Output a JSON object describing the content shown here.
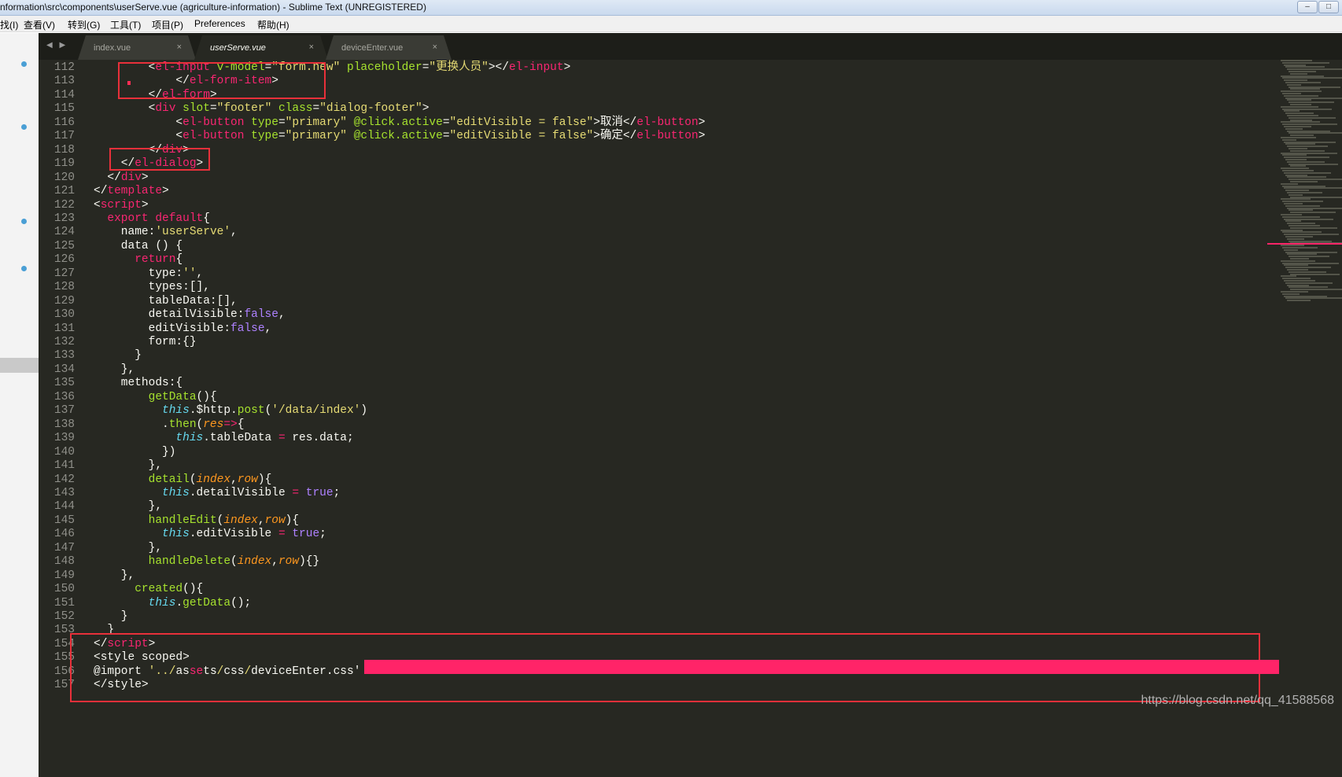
{
  "window": {
    "title": "nformation\\src\\components\\userServe.vue (agriculture-information) - Sublime Text (UNREGISTERED)",
    "buttons": [
      "–",
      "□"
    ]
  },
  "menu": [
    "找(I)",
    "查看(V)",
    "转到(G)",
    "工具(T)",
    "项目(P)",
    "Preferences",
    "帮助(H)"
  ],
  "tabs": {
    "nav": "◀ ▶",
    "items": [
      {
        "label": "index.vue",
        "close": "×",
        "active": false
      },
      {
        "label": "userServe.vue",
        "close": "×",
        "active": true
      },
      {
        "label": "deviceEnter.vue",
        "close": "×",
        "active": false
      }
    ]
  },
  "lines": [
    {
      "n": "112",
      "t": [
        [
          "        ",
          "txt"
        ],
        [
          "<",
          "txt"
        ],
        [
          "el-input",
          "tag"
        ],
        [
          " v-model",
          "attr"
        ],
        [
          "=",
          "txt"
        ],
        [
          "\"form.new\"",
          "str"
        ],
        [
          " placeholder",
          "attr"
        ],
        [
          "=",
          "txt"
        ],
        [
          "\"更换人员\"",
          "str"
        ],
        [
          "></",
          "txt"
        ],
        [
          "el-input",
          "tag"
        ],
        [
          ">",
          "txt"
        ]
      ]
    },
    {
      "n": "113",
      "t": [
        [
          "            </",
          "txt"
        ],
        [
          "el-form-item",
          "tag"
        ],
        [
          ">",
          "txt"
        ]
      ]
    },
    {
      "n": "114",
      "t": [
        [
          "        </",
          "txt"
        ],
        [
          "el-form",
          "tag"
        ],
        [
          ">",
          "txt"
        ]
      ]
    },
    {
      "n": "115",
      "t": [
        [
          "        <",
          "txt"
        ],
        [
          "div",
          "tag"
        ],
        [
          " slot",
          "attr"
        ],
        [
          "=",
          "txt"
        ],
        [
          "\"footer\"",
          "str"
        ],
        [
          " class",
          "attr"
        ],
        [
          "=",
          "txt"
        ],
        [
          "\"dialog-footer\"",
          "str"
        ],
        [
          ">",
          "txt"
        ]
      ]
    },
    {
      "n": "116",
      "t": [
        [
          "            <",
          "txt"
        ],
        [
          "el-button",
          "tag"
        ],
        [
          " type",
          "attr"
        ],
        [
          "=",
          "txt"
        ],
        [
          "\"primary\"",
          "str"
        ],
        [
          " @click.active",
          "attr"
        ],
        [
          "=",
          "txt"
        ],
        [
          "\"editVisible = false\"",
          "str"
        ],
        [
          ">取消</",
          "txt"
        ],
        [
          "el-button",
          "tag"
        ],
        [
          ">",
          "txt"
        ]
      ]
    },
    {
      "n": "117",
      "t": [
        [
          "            <",
          "txt"
        ],
        [
          "el-button",
          "tag"
        ],
        [
          " type",
          "attr"
        ],
        [
          "=",
          "txt"
        ],
        [
          "\"primary\"",
          "str"
        ],
        [
          " @click.active",
          "attr"
        ],
        [
          "=",
          "txt"
        ],
        [
          "\"editVisible = false\"",
          "str"
        ],
        [
          ">确定</",
          "txt"
        ],
        [
          "el-button",
          "tag"
        ],
        [
          ">",
          "txt"
        ]
      ]
    },
    {
      "n": "118",
      "t": [
        [
          "        </",
          "txt"
        ],
        [
          "div",
          "tag"
        ],
        [
          ">",
          "txt"
        ]
      ]
    },
    {
      "n": "119",
      "t": [
        [
          "    </",
          "txt"
        ],
        [
          "el-dialog",
          "tag"
        ],
        [
          ">",
          "txt"
        ]
      ]
    },
    {
      "n": "120",
      "t": [
        [
          "  </",
          "txt"
        ],
        [
          "div",
          "tag"
        ],
        [
          ">",
          "txt"
        ]
      ]
    },
    {
      "n": "121",
      "t": [
        [
          "</",
          "txt"
        ],
        [
          "template",
          "tag"
        ],
        [
          ">",
          "txt"
        ]
      ]
    },
    {
      "n": "122",
      "t": [
        [
          "<",
          "txt"
        ],
        [
          "script",
          "tag"
        ],
        [
          ">",
          "txt"
        ]
      ]
    },
    {
      "n": "123",
      "t": [
        [
          "  ",
          "txt"
        ],
        [
          "export default",
          "kw"
        ],
        [
          "{",
          "txt"
        ]
      ]
    },
    {
      "n": "124",
      "t": [
        [
          "    name:",
          "txt"
        ],
        [
          "'userServe'",
          "str"
        ],
        [
          ",",
          "txt"
        ]
      ]
    },
    {
      "n": "125",
      "t": [
        [
          "    data () {",
          "txt"
        ]
      ]
    },
    {
      "n": "126",
      "t": [
        [
          "      ",
          "txt"
        ],
        [
          "return",
          "kw"
        ],
        [
          "{",
          "txt"
        ]
      ]
    },
    {
      "n": "127",
      "t": [
        [
          "        type:",
          "txt"
        ],
        [
          "''",
          "str"
        ],
        [
          ",",
          "txt"
        ]
      ]
    },
    {
      "n": "128",
      "t": [
        [
          "        types:[],",
          "txt"
        ]
      ]
    },
    {
      "n": "129",
      "t": [
        [
          "        tableData:[],",
          "txt"
        ]
      ]
    },
    {
      "n": "130",
      "t": [
        [
          "        detailVisible:",
          "txt"
        ],
        [
          "false",
          "const"
        ],
        [
          ",",
          "txt"
        ]
      ]
    },
    {
      "n": "131",
      "t": [
        [
          "        editVisible:",
          "txt"
        ],
        [
          "false",
          "const"
        ],
        [
          ",",
          "txt"
        ]
      ]
    },
    {
      "n": "132",
      "t": [
        [
          "        form:{}",
          "txt"
        ]
      ]
    },
    {
      "n": "133",
      "t": [
        [
          "      }",
          "txt"
        ]
      ]
    },
    {
      "n": "134",
      "t": [
        [
          "    },",
          "txt"
        ]
      ]
    },
    {
      "n": "135",
      "t": [
        [
          "    methods:{",
          "txt"
        ]
      ]
    },
    {
      "n": "136",
      "t": [
        [
          "        ",
          "txt"
        ],
        [
          "getData",
          "fn"
        ],
        [
          "(){",
          "txt"
        ]
      ]
    },
    {
      "n": "137",
      "t": [
        [
          "          ",
          "txt"
        ],
        [
          "this",
          "this"
        ],
        [
          ".$http.",
          "txt"
        ],
        [
          "post",
          "fn"
        ],
        [
          "(",
          "txt"
        ],
        [
          "'/data/index'",
          "str"
        ],
        [
          ")",
          "txt"
        ]
      ]
    },
    {
      "n": "138",
      "t": [
        [
          "          .",
          "txt"
        ],
        [
          "then",
          "fn"
        ],
        [
          "(",
          "txt"
        ],
        [
          "res",
          "param"
        ],
        [
          "=>",
          "op"
        ],
        [
          "{",
          "txt"
        ]
      ]
    },
    {
      "n": "139",
      "t": [
        [
          "            ",
          "txt"
        ],
        [
          "this",
          "this"
        ],
        [
          ".tableData ",
          "txt"
        ],
        [
          "=",
          "op"
        ],
        [
          " res.data;",
          "txt"
        ]
      ]
    },
    {
      "n": "140",
      "t": [
        [
          "          })",
          "txt"
        ]
      ]
    },
    {
      "n": "141",
      "t": [
        [
          "        },",
          "txt"
        ]
      ]
    },
    {
      "n": "142",
      "t": [
        [
          "        ",
          "txt"
        ],
        [
          "detail",
          "fn"
        ],
        [
          "(",
          "txt"
        ],
        [
          "index",
          "param"
        ],
        [
          ",",
          "txt"
        ],
        [
          "row",
          "param"
        ],
        [
          "){",
          "txt"
        ]
      ]
    },
    {
      "n": "143",
      "t": [
        [
          "          ",
          "txt"
        ],
        [
          "this",
          "this"
        ],
        [
          ".detailVisible ",
          "txt"
        ],
        [
          "=",
          "op"
        ],
        [
          " ",
          "txt"
        ],
        [
          "true",
          "const"
        ],
        [
          ";",
          "txt"
        ]
      ]
    },
    {
      "n": "144",
      "t": [
        [
          "        },",
          "txt"
        ]
      ]
    },
    {
      "n": "145",
      "t": [
        [
          "        ",
          "txt"
        ],
        [
          "handleEdit",
          "fn"
        ],
        [
          "(",
          "txt"
        ],
        [
          "index",
          "param"
        ],
        [
          ",",
          "txt"
        ],
        [
          "row",
          "param"
        ],
        [
          "){",
          "txt"
        ]
      ]
    },
    {
      "n": "146",
      "t": [
        [
          "          ",
          "txt"
        ],
        [
          "this",
          "this"
        ],
        [
          ".editVisible ",
          "txt"
        ],
        [
          "=",
          "op"
        ],
        [
          " ",
          "txt"
        ],
        [
          "true",
          "const"
        ],
        [
          ";",
          "txt"
        ]
      ]
    },
    {
      "n": "147",
      "t": [
        [
          "        },",
          "txt"
        ]
      ]
    },
    {
      "n": "148",
      "t": [
        [
          "        ",
          "txt"
        ],
        [
          "handleDelete",
          "fn"
        ],
        [
          "(",
          "txt"
        ],
        [
          "index",
          "param"
        ],
        [
          ",",
          "txt"
        ],
        [
          "row",
          "param"
        ],
        [
          "){}",
          "txt"
        ]
      ]
    },
    {
      "n": "149",
      "t": [
        [
          "    },",
          "txt"
        ]
      ]
    },
    {
      "n": "150",
      "t": [
        [
          "      ",
          "txt"
        ],
        [
          "created",
          "fn"
        ],
        [
          "(){",
          "txt"
        ]
      ]
    },
    {
      "n": "151",
      "t": [
        [
          "        ",
          "txt"
        ],
        [
          "this",
          "this"
        ],
        [
          ".",
          "txt"
        ],
        [
          "getData",
          "fn"
        ],
        [
          "();",
          "txt"
        ]
      ]
    },
    {
      "n": "152",
      "t": [
        [
          "    }",
          "txt"
        ]
      ]
    },
    {
      "n": "153",
      "t": [
        [
          "  }",
          "txt"
        ]
      ]
    },
    {
      "n": "154",
      "t": [
        [
          "</",
          "txt"
        ],
        [
          "script",
          "tag"
        ],
        [
          ">",
          "txt"
        ]
      ]
    },
    {
      "n": "155",
      "t": [
        [
          "<style scoped>",
          "txt"
        ]
      ]
    },
    {
      "n": "156",
      "t": [
        [
          "@import ",
          "txt"
        ],
        [
          "'../",
          "str"
        ],
        [
          "as",
          "txt"
        ],
        [
          "se",
          "tag"
        ],
        [
          "ts",
          "txt"
        ],
        [
          "/",
          "str"
        ],
        [
          "css",
          "txt"
        ],
        [
          "/",
          "str"
        ],
        [
          "deviceEnter.css'",
          "txt"
        ]
      ]
    },
    {
      "n": "157",
      "t": [
        [
          "</style>",
          "txt"
        ]
      ]
    }
  ],
  "watermark": "https://blog.csdn.net/qq_41588568",
  "colors": {
    "editor_bg": "#272822",
    "highlight_box": "#e8303a",
    "pink_bar": "#ff2468"
  }
}
